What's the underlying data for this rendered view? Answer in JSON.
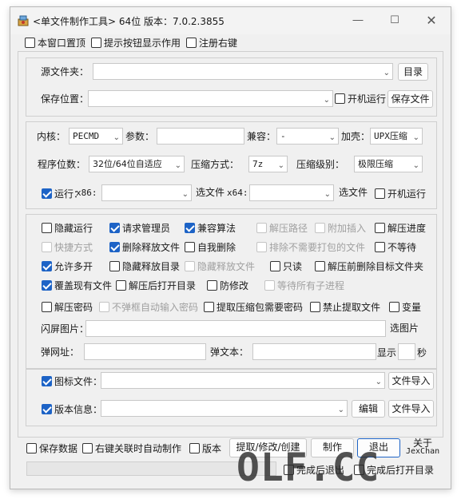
{
  "window": {
    "title": "<单文件制作工具> 64位 版本：7.0.2.3855",
    "min_icon": "minimize-icon",
    "max_icon": "maximize-icon",
    "close_icon": "close-icon"
  },
  "top_options": {
    "stay_on_top": "本窗口置顶",
    "show_tooltips": "提示按钮显示作用",
    "register_context": "注册右键"
  },
  "source": {
    "source_folder_label": "源文件夹：",
    "dir_button": "目录",
    "save_location_label": "保存位置：",
    "autorun_label": "开机运行",
    "save_file_button": "保存文件"
  },
  "engine": {
    "kernel_label": "内核：",
    "kernel_value": "PECMD",
    "params_label": "参数：",
    "compat_label": "兼容：",
    "compat_value": "-",
    "shell_label": "加壳：",
    "shell_value": "UPX压缩",
    "bits_label": "程序位数：",
    "bits_value": "32位/64位自适应",
    "compress_method_label": "压缩方式：",
    "compress_method_value": "7z",
    "compress_level_label": "压缩级别：",
    "compress_level_value": "极限压缩",
    "run_label": "运行：",
    "x86_label": "x86:",
    "choose_file_1": "选文件",
    "x64_label": "x64:",
    "choose_file_2": "选文件",
    "run_autorun_label": "开机运行"
  },
  "options": {
    "row1": [
      {
        "label": "隐藏运行",
        "checked": false,
        "disabled": false
      },
      {
        "label": "请求管理员",
        "checked": true,
        "disabled": false
      },
      {
        "label": "兼容算法",
        "checked": true,
        "disabled": false
      },
      {
        "label": "解压路径",
        "checked": false,
        "disabled": true
      },
      {
        "label": "附加插入",
        "checked": false,
        "disabled": true
      },
      {
        "label": "解压进度",
        "checked": false,
        "disabled": false
      }
    ],
    "row2": [
      {
        "label": "快捷方式",
        "checked": false,
        "disabled": true
      },
      {
        "label": "删除释放文件",
        "checked": true,
        "disabled": false
      },
      {
        "label": "自我删除",
        "checked": false,
        "disabled": false
      },
      {
        "label": "排除不需要打包的文件",
        "checked": false,
        "disabled": true
      },
      {
        "label": "不等待",
        "checked": false,
        "disabled": false
      }
    ],
    "row3": [
      {
        "label": "允许多开",
        "checked": true,
        "disabled": false
      },
      {
        "label": "隐藏释放目录",
        "checked": false,
        "disabled": false
      },
      {
        "label": "隐藏释放文件",
        "checked": false,
        "disabled": true
      },
      {
        "label": "只读",
        "checked": false,
        "disabled": false
      },
      {
        "label": "解压前删除目标文件夹",
        "checked": false,
        "disabled": false
      }
    ],
    "row4": [
      {
        "label": "覆盖现有文件",
        "checked": true,
        "disabled": false
      },
      {
        "label": "解压后打开目录",
        "checked": false,
        "disabled": false
      },
      {
        "label": "防修改",
        "checked": false,
        "disabled": false
      },
      {
        "label": "等待所有子进程",
        "checked": false,
        "disabled": true
      }
    ],
    "row5": [
      {
        "label": "解压密码",
        "checked": false,
        "disabled": false
      },
      {
        "label": "不弹框自动输入密码",
        "checked": false,
        "disabled": true
      },
      {
        "label": "提取压缩包需要密码",
        "checked": false,
        "disabled": false
      },
      {
        "label": "禁止提取文件",
        "checked": false,
        "disabled": false
      },
      {
        "label": "变量",
        "checked": false,
        "disabled": false
      }
    ],
    "splash_label": "闪屏图片：",
    "choose_image_button": "选图片",
    "popup_url_label": "弹网址：",
    "popup_text_label": "弹文本：",
    "show_label": "显示",
    "seconds_label": "秒"
  },
  "resources": {
    "icon_file_label": "图标文件：",
    "icon_import_button": "文件导入",
    "version_info_label": "版本信息：",
    "edit_button": "编辑",
    "version_import_button": "文件导入"
  },
  "bottom": {
    "save_data": "保存数据",
    "auto_make": "右键关联时自动制作",
    "version": "版本",
    "extract_button": "提取/修改/创建",
    "make_button": "制作",
    "exit_button": "退出",
    "about_label": "关于",
    "author_label": "JexChan",
    "exit_after_done": "完成后退出",
    "open_dir_after_done": "完成后打开目录",
    "watermark": "OLF.CC"
  }
}
